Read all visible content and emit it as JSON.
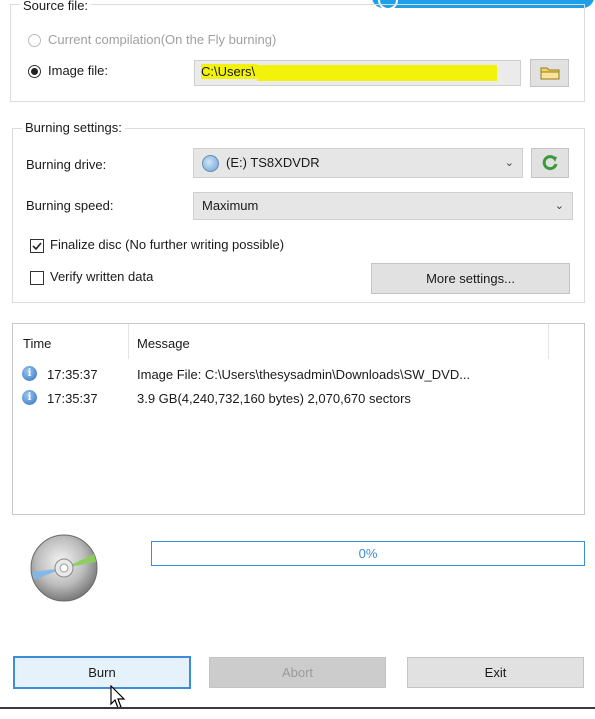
{
  "source": {
    "legend": "Source file:",
    "current_compilation_label": "Current compilation(On the Fly burning)",
    "image_file_label": "Image file:",
    "image_file_value": "C:\\Users\\",
    "selected_option": "Image file"
  },
  "burning": {
    "legend": "Burning settings:",
    "drive_label": "Burning drive:",
    "drive_value": "(E:) TS8XDVDR",
    "speed_label": "Burning speed:",
    "speed_value": "Maximum",
    "finalize_label": "Finalize disc (No further writing possible)",
    "finalize_checked": true,
    "verify_label": "Verify written data",
    "verify_checked": false,
    "more_settings_label": "More settings..."
  },
  "log": {
    "columns": [
      "Time",
      "Message"
    ],
    "rows": [
      {
        "time": "17:35:37",
        "message": "Image File:  C:\\Users\\thesysadmin\\Downloads\\SW_DVD..."
      },
      {
        "time": "17:35:37",
        "message": "3.9 GB(4,240,732,160 bytes)  2,070,670 sectors"
      }
    ]
  },
  "progress": {
    "text": "0%",
    "value": 0
  },
  "buttons": {
    "burn": "Burn",
    "abort": "Abort",
    "exit": "Exit"
  },
  "colors": {
    "highlight": "#f2f20a",
    "progress_border": "#3c8cd6",
    "accent": "#3c8cd6"
  }
}
